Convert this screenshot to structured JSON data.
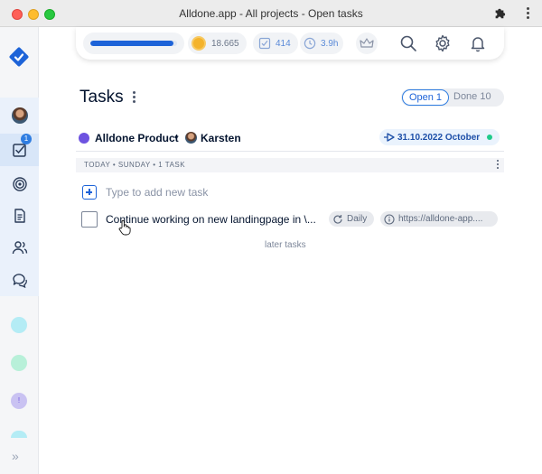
{
  "window": {
    "title": "Alldone.app - All projects - Open tasks"
  },
  "colors": {
    "accent": "#1d63d8",
    "project": "#6d53e0",
    "status_dot": "#1fcb8a",
    "gold": "#f4b32b"
  },
  "sidebar": {
    "logo_icon": "alldone-logo-icon",
    "items": [
      {
        "name": "user-avatar",
        "icon": "avatar"
      },
      {
        "name": "tasks",
        "icon": "checkbox-icon",
        "badge": "1",
        "active": true
      },
      {
        "name": "goals",
        "icon": "target-icon"
      },
      {
        "name": "notes",
        "icon": "document-icon"
      },
      {
        "name": "contacts",
        "icon": "people-icon"
      },
      {
        "name": "chats",
        "icon": "chat-icon"
      }
    ],
    "project_dots": [
      {
        "color": "#b4ecf5",
        "label": ""
      },
      {
        "color": "#b8f0d9",
        "label": ""
      },
      {
        "color": "#c9c2f2",
        "label": "!"
      },
      {
        "color": "#b4ecf5",
        "label": ""
      }
    ],
    "expand_icon": "chevrons-right-icon"
  },
  "topbar": {
    "progress": 0.96,
    "gold": "18.665",
    "tasks_done": "414",
    "time_logged": "3.9h"
  },
  "header": {
    "title": "Tasks",
    "toggle": {
      "open_label": "Open 1",
      "done_label": "Done 10"
    }
  },
  "project": {
    "name": "Alldone Product",
    "separator": "•",
    "owner": "Karsten",
    "deadline": "31.10.2022 October"
  },
  "day_section": {
    "label": "TODAY • SUNDAY • 1 TASK"
  },
  "add_task": {
    "placeholder": "Type to add new task"
  },
  "tasks": [
    {
      "title": "Continue working on new landingpage in \\...",
      "recurrence": "Daily",
      "link": "https://alldone-app...."
    }
  ],
  "later_tasks_label": "later tasks"
}
